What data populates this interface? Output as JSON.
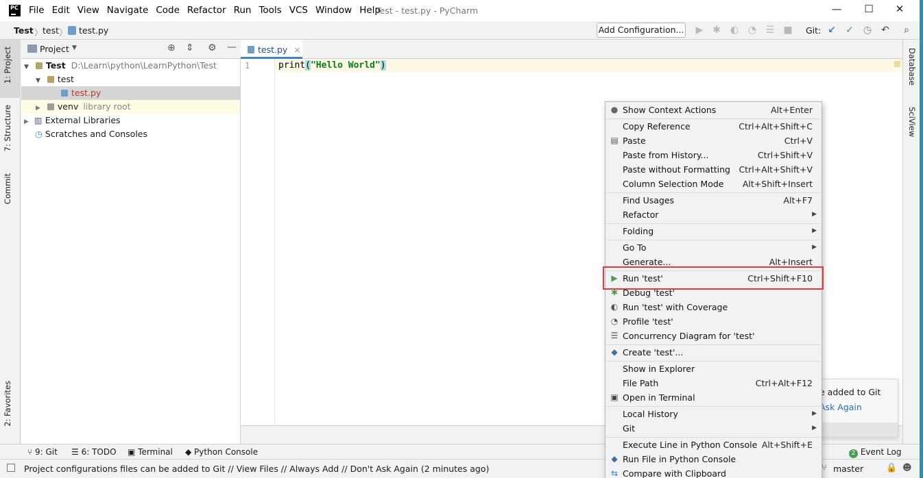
{
  "window": {
    "app_logo": "PC",
    "title": "Test - test.py - PyCharm",
    "menu": [
      "File",
      "Edit",
      "View",
      "Navigate",
      "Code",
      "Refactor",
      "Run",
      "Tools",
      "VCS",
      "Window",
      "Help"
    ],
    "controls": {
      "minimize": "—",
      "maximize": "☐",
      "close": "✕"
    }
  },
  "navbar": {
    "breadcrumbs": [
      "Test",
      "test",
      "test.py"
    ],
    "add_config_label": "Add Configuration...",
    "git_label": "Git:"
  },
  "left_strip": {
    "project": "1: Project",
    "structure": "7: Structure",
    "commit": "Commit",
    "favorites": "2: Favorites"
  },
  "right_strip": {
    "database": "Database",
    "sciview": "SciView"
  },
  "project_panel": {
    "title": "Project",
    "tree": [
      {
        "name": "Test",
        "path": "D:\\Learn\\python\\LearnPython\\Test"
      },
      {
        "name": "test"
      },
      {
        "name": "test.py"
      },
      {
        "name": "venv",
        "note": "library root"
      },
      {
        "name": "External Libraries"
      },
      {
        "name": "Scratches and Consoles"
      }
    ]
  },
  "editor": {
    "tab_label": "test.py",
    "line_number": "1",
    "code": {
      "fn": "print",
      "open": "(",
      "str": "\"Hello World\"",
      "close": ")"
    }
  },
  "context_menu": {
    "items": [
      {
        "label": "Show Context Actions",
        "shortcut": "Alt+Enter",
        "icon": "bulb-icon"
      },
      {
        "label": "Copy Reference",
        "shortcut": "Ctrl+Alt+Shift+C"
      },
      {
        "label": "Paste",
        "shortcut": "Ctrl+V",
        "icon": "clipboard-icon"
      },
      {
        "label": "Paste from History...",
        "shortcut": "Ctrl+Shift+V"
      },
      {
        "label": "Paste without Formatting",
        "shortcut": "Ctrl+Alt+Shift+V"
      },
      {
        "label": "Column Selection Mode",
        "shortcut": "Alt+Shift+Insert"
      },
      {
        "label": "Find Usages",
        "shortcut": "Alt+F7"
      },
      {
        "label": "Refactor",
        "submenu": true
      },
      {
        "label": "Folding",
        "submenu": true
      },
      {
        "label": "Go To",
        "submenu": true
      },
      {
        "label": "Generate...",
        "shortcut": "Alt+Insert"
      },
      {
        "label": "Run 'test'",
        "shortcut": "Ctrl+Shift+F10",
        "icon": "run-icon"
      },
      {
        "label": "Debug 'test'",
        "icon": "debug-icon"
      },
      {
        "label": "Run 'test' with Coverage",
        "icon": "coverage-icon"
      },
      {
        "label": "Profile 'test'",
        "icon": "profile-icon"
      },
      {
        "label": "Concurrency Diagram for 'test'",
        "icon": "concurrency-icon"
      },
      {
        "label": "Create 'test'...",
        "icon": "python-icon"
      },
      {
        "label": "Show in Explorer"
      },
      {
        "label": "File Path",
        "shortcut": "Ctrl+Alt+F12"
      },
      {
        "label": "Open in Terminal",
        "icon": "terminal-icon"
      },
      {
        "label": "Local History",
        "submenu": true
      },
      {
        "label": "Git",
        "submenu": true
      },
      {
        "label": "Execute Line in Python Console",
        "shortcut": "Alt+Shift+E"
      },
      {
        "label": "Run File in Python Console",
        "icon": "python-icon"
      },
      {
        "label": "Compare with Clipboard",
        "icon": "compare-icon"
      }
    ]
  },
  "notification": {
    "text": "e added to Git",
    "link": "Ask Again"
  },
  "tool_windows": {
    "git": "9: Git",
    "todo": "6: TODO",
    "terminal": "Terminal",
    "python_console": "Python Console",
    "event_log": "Event Log",
    "event_count": "2"
  },
  "status": {
    "message": "Project configurations files can be added to Git // View Files // Always Add // Don't Ask Again (2 minutes ago)",
    "branch": "master"
  },
  "colors": {
    "accent": "#4083c9",
    "run_green": "#499c54",
    "highlight_box": "#e03c3c"
  }
}
